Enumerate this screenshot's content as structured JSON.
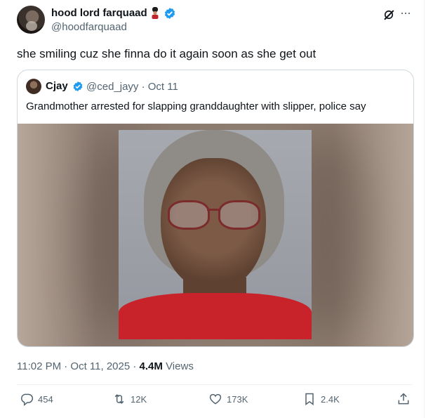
{
  "post": {
    "author_name": "hood lord farquaad",
    "author_handle": "@hoodfarquaad",
    "text": "she smiling cuz she finna do it again soon as she get out",
    "time": "11:02 PM · Oct 11, 2025",
    "view_count": "4.4M",
    "views_label": "Views"
  },
  "quote": {
    "author_name": "Cjay",
    "handle_date": "@ced_jayy · Oct 11",
    "text": "Grandmother arrested for slapping granddaughter with slipper, police say"
  },
  "actions": {
    "replies": "454",
    "reposts": "12K",
    "likes": "173K",
    "bookmarks": "2.4K"
  },
  "icons": {
    "verified": "verified-badge-icon",
    "emoji": "guard-emoji-icon",
    "grok": "grok-icon",
    "more": "more-icon",
    "reply": "reply-icon",
    "repost": "repost-icon",
    "like": "heart-icon",
    "bookmark": "bookmark-icon",
    "share": "share-icon"
  },
  "colors": {
    "verified": "#1d9bf0",
    "secondary_text": "#536471"
  }
}
